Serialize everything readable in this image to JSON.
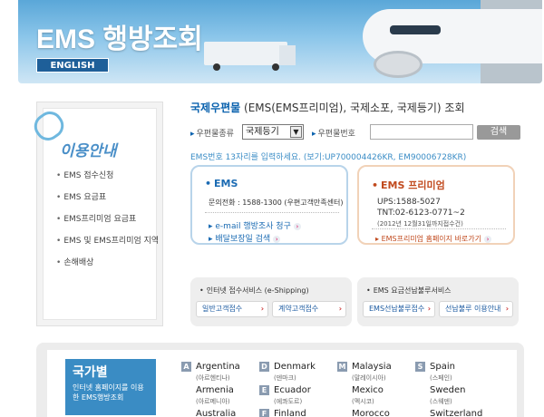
{
  "header": {
    "title": "EMS 행방조회",
    "english_button": "ENGLISH"
  },
  "sidebar": {
    "title": "이용안내",
    "items": [
      {
        "label": "EMS 접수신청"
      },
      {
        "label": "EMS 요금표"
      },
      {
        "label": "EMS프리미엄 요금표"
      },
      {
        "label": "EMS 및 EMS프리미엄 지역"
      },
      {
        "label": "손해배상"
      }
    ]
  },
  "main": {
    "title_highlight": "국제우편물",
    "title_rest": " (EMS(EMS프리미엄), 국제소포, 국제등기) 조회",
    "type_label": "우편물종류",
    "type_value": "국제등기",
    "number_label": "우편물번호",
    "number_value": "",
    "search_button": "검색",
    "hint": "EMS번호 13자리를 입력하세요. (보기:UP700004426KR, EM90006728KR)"
  },
  "ems_box": {
    "title": "EMS",
    "phone": "문의전화 : 1588-1300 (우편고객만족센터)",
    "link1": "e-mail 행방조사 청구",
    "link2": "배달보장일 검색"
  },
  "premium_box": {
    "title": "EMS 프리미엄",
    "ups": "UPS:1588-5027",
    "tnt": "TNT:02-6123-0771~2",
    "note": "(2012년 12월31일까지접수건)",
    "link": "EMS프리미엄 홈페이지 바로가기"
  },
  "service_left": {
    "title": "인터넷 접수서비스 (e-Shipping)",
    "btn1": "일반고객접수",
    "btn2": "계약고객접수"
  },
  "service_right": {
    "title": "EMS 요금선납불루서비스",
    "btn1": "EMS선납불루접수",
    "btn2": "선납불루 이용안내"
  },
  "countries": {
    "label_big": "국가별",
    "label_small": "인터넷 홈페이지를 이용한 EMS행방조회",
    "columns": [
      {
        "letter": "A",
        "items": [
          {
            "name": "Argentina",
            "kr": "(아르헨티나)"
          },
          {
            "name": "Armenia",
            "kr": "(아르메니아)"
          },
          {
            "name": "Australia",
            "kr": ""
          }
        ]
      },
      {
        "letter": "D",
        "items": [
          {
            "name": "Denmark",
            "kr": "(덴마크)"
          },
          {
            "name": "Ecuador",
            "kr": "(에콰도르)"
          },
          {
            "name": "Finland",
            "kr": ""
          }
        ]
      },
      {
        "letter": "M",
        "items": [
          {
            "name": "Malaysia",
            "kr": "(말레이시아)"
          },
          {
            "name": "Mexico",
            "kr": "(멕시코)"
          },
          {
            "name": "Morocco",
            "kr": ""
          }
        ]
      },
      {
        "letter": "S",
        "items": [
          {
            "name": "Spain",
            "kr": "(스페인)"
          },
          {
            "name": "Sweden",
            "kr": "(스웨덴)"
          },
          {
            "name": "Switzerland",
            "kr": ""
          }
        ]
      }
    ],
    "extra_letters": {
      "E": "E",
      "F": "F"
    }
  }
}
